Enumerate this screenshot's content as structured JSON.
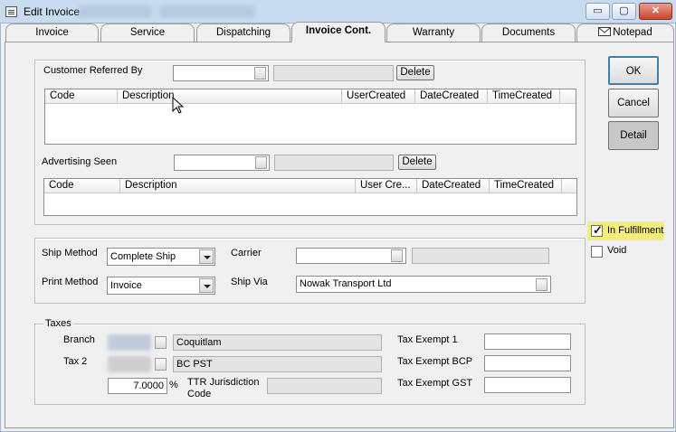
{
  "window": {
    "title": "Edit Invoice",
    "minimize_glyph": "▭",
    "maximize_glyph": "▢",
    "close_glyph": "✕"
  },
  "tabs": [
    {
      "label": "Invoice"
    },
    {
      "label": "Service"
    },
    {
      "label": "Dispatching"
    },
    {
      "label": "Invoice Cont."
    },
    {
      "label": "Warranty"
    },
    {
      "label": "Documents"
    },
    {
      "label": "Notepad",
      "icon": "envelope-icon"
    }
  ],
  "active_tab": "Invoice Cont.",
  "customer_referred": {
    "label": "Customer Referred By",
    "value": "",
    "description": "",
    "delete_label": "Delete",
    "columns": [
      "Code",
      "Description",
      "UserCreated",
      "DateCreated",
      "TimeCreated"
    ]
  },
  "advertising": {
    "label": "Advertising Seen",
    "value": "",
    "description": "",
    "delete_label": "Delete",
    "columns": [
      "Code",
      "Description",
      "User Cre...",
      "DateCreated",
      "TimeCreated"
    ]
  },
  "shipping": {
    "ship_method_label": "Ship Method",
    "ship_method_value": "Complete Ship",
    "print_method_label": "Print Method",
    "print_method_value": "Invoice",
    "carrier_label": "Carrier",
    "carrier_value": "",
    "carrier_description": "",
    "ship_via_label": "Ship Via",
    "ship_via_value": "Nowak Transport Ltd"
  },
  "taxes": {
    "group_label": "Taxes",
    "branch_label": "Branch",
    "branch_name": "Coquitlam",
    "tax2_label": "Tax 2",
    "tax2_name": "BC PST",
    "rate_value": "7.0000",
    "percent_symbol": "%",
    "ttr_label_line1": "TTR Jurisdiction",
    "ttr_label_line2": "Code",
    "ttr_value": "",
    "tax_exempt_1_label": "Tax Exempt 1",
    "tax_exempt_1_value": "",
    "tax_exempt_bcp_label": "Tax Exempt BCP",
    "tax_exempt_bcp_value": "",
    "tax_exempt_gst_label": "Tax Exempt GST",
    "tax_exempt_gst_value": ""
  },
  "buttons": {
    "ok": "OK",
    "cancel": "Cancel",
    "detail": "Detail"
  },
  "flags": {
    "in_fulfillment_label": "In Fulfillment",
    "in_fulfillment_checked": true,
    "void_label": "Void",
    "void_checked": false
  },
  "colors": {
    "highlight": "#f3ee7a",
    "titlebar": "#c9dcef"
  }
}
